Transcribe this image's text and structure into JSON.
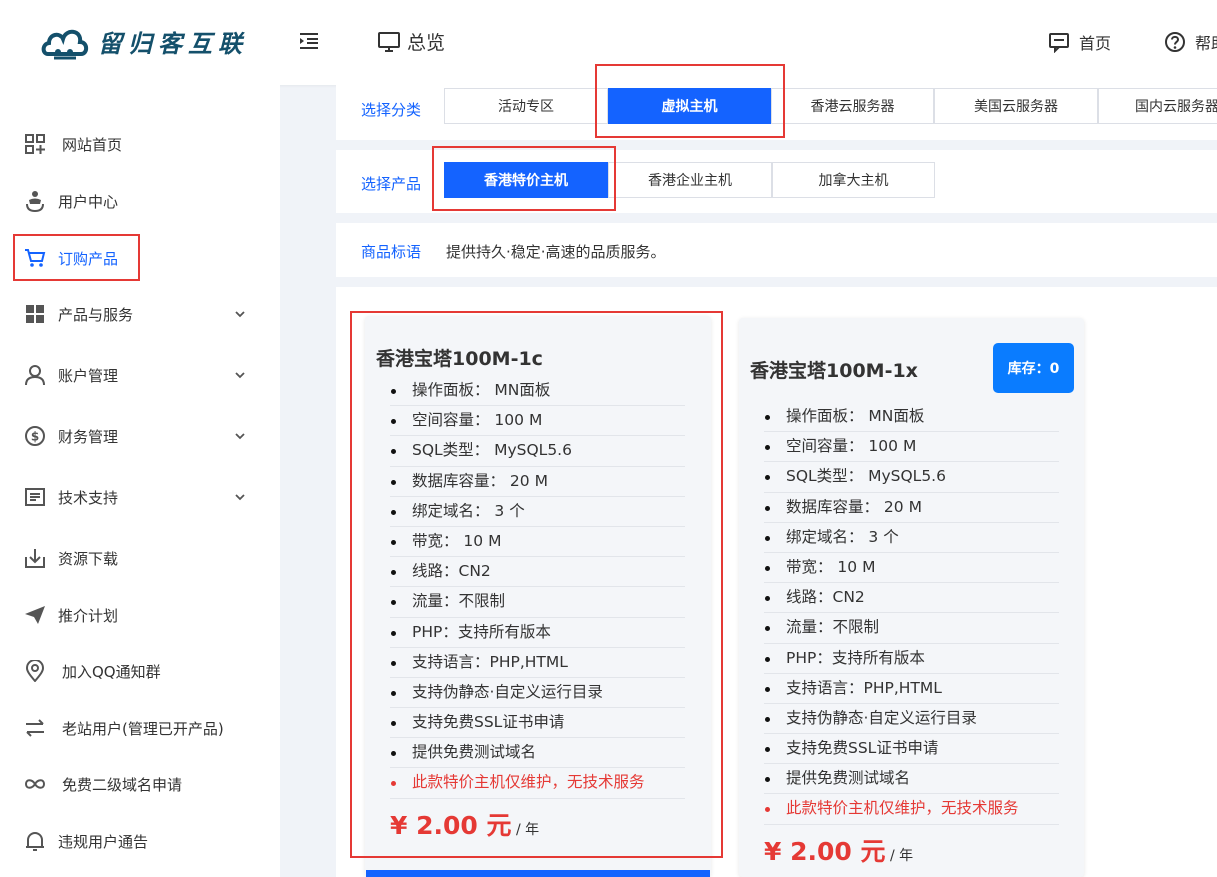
{
  "header": {
    "logo_text": "留归客互联",
    "overview_label": "总览",
    "home_label": "首页",
    "help_label": "帮助"
  },
  "sidebar": {
    "items": [
      {
        "label": "网站首页",
        "icon": "dashboard-icon"
      },
      {
        "label": "用户中心",
        "icon": "user-center-icon"
      },
      {
        "label": "订购产品",
        "icon": "cart-icon",
        "active": true
      },
      {
        "label": "产品与服务",
        "icon": "grid-icon",
        "expandable": true
      },
      {
        "label": "账户管理",
        "icon": "person-icon",
        "expandable": true
      },
      {
        "label": "财务管理",
        "icon": "dollar-icon",
        "expandable": true
      },
      {
        "label": "技术支持",
        "icon": "document-icon",
        "expandable": true
      },
      {
        "label": "资源下载",
        "icon": "download-icon"
      },
      {
        "label": "推介计划",
        "icon": "send-icon"
      },
      {
        "label": "加入QQ通知群",
        "icon": "location-icon"
      },
      {
        "label": "老站用户(管理已开产品)",
        "icon": "swap-icon"
      },
      {
        "label": "免费二级域名申请",
        "icon": "infinity-icon"
      },
      {
        "label": "违规用户通告",
        "icon": "bell-icon"
      }
    ]
  },
  "category": {
    "label": "选择分类",
    "tabs": [
      "活动专区",
      "虚拟主机",
      "香港云服务器",
      "美国云服务器",
      "国内云服务器"
    ],
    "selected": "虚拟主机"
  },
  "product_select": {
    "label": "选择产品",
    "tabs": [
      "香港特价主机",
      "香港企业主机",
      "加拿大主机"
    ],
    "selected": "香港特价主机"
  },
  "slogan": {
    "label": "商品标语",
    "text": "提供持久·稳定·高速的品质服务。"
  },
  "products": [
    {
      "title": "香港宝塔100M-1c",
      "features": [
        "操作面板： MN面板",
        "空间容量： 100 M",
        "SQL类型： MySQL5.6",
        "数据库容量： 20 M",
        "绑定域名： 3 个",
        "带宽： 10 M",
        "线路：CN2",
        "流量：不限制",
        "PHP：支持所有版本",
        "支持语言：PHP,HTML",
        "支持伪静态·自定义运行目录",
        "支持免费SSL证书申请",
        "提供免费测试域名"
      ],
      "warning": "此款特价主机仅维护，无技术服务",
      "price": "¥ 2.00 元",
      "price_unit": " / 年"
    },
    {
      "title": "香港宝塔100M-1x",
      "stock": "库存：0",
      "features": [
        "操作面板： MN面板",
        "空间容量： 100 M",
        "SQL类型： MySQL5.6",
        "数据库容量： 20 M",
        "绑定域名： 3 个",
        "带宽： 10 M",
        "线路：CN2",
        "流量：不限制",
        "PHP：支持所有版本",
        "支持语言：PHP,HTML",
        "支持伪静态·自定义运行目录",
        "支持免费SSL证书申请",
        "提供免费测试域名"
      ],
      "warning": "此款特价主机仅维护，无技术服务",
      "price": "¥ 2.00 元",
      "price_unit": " / 年"
    }
  ],
  "colors": {
    "accent": "#1463ff",
    "highlight": "#e53935",
    "logo": "#14506b"
  }
}
